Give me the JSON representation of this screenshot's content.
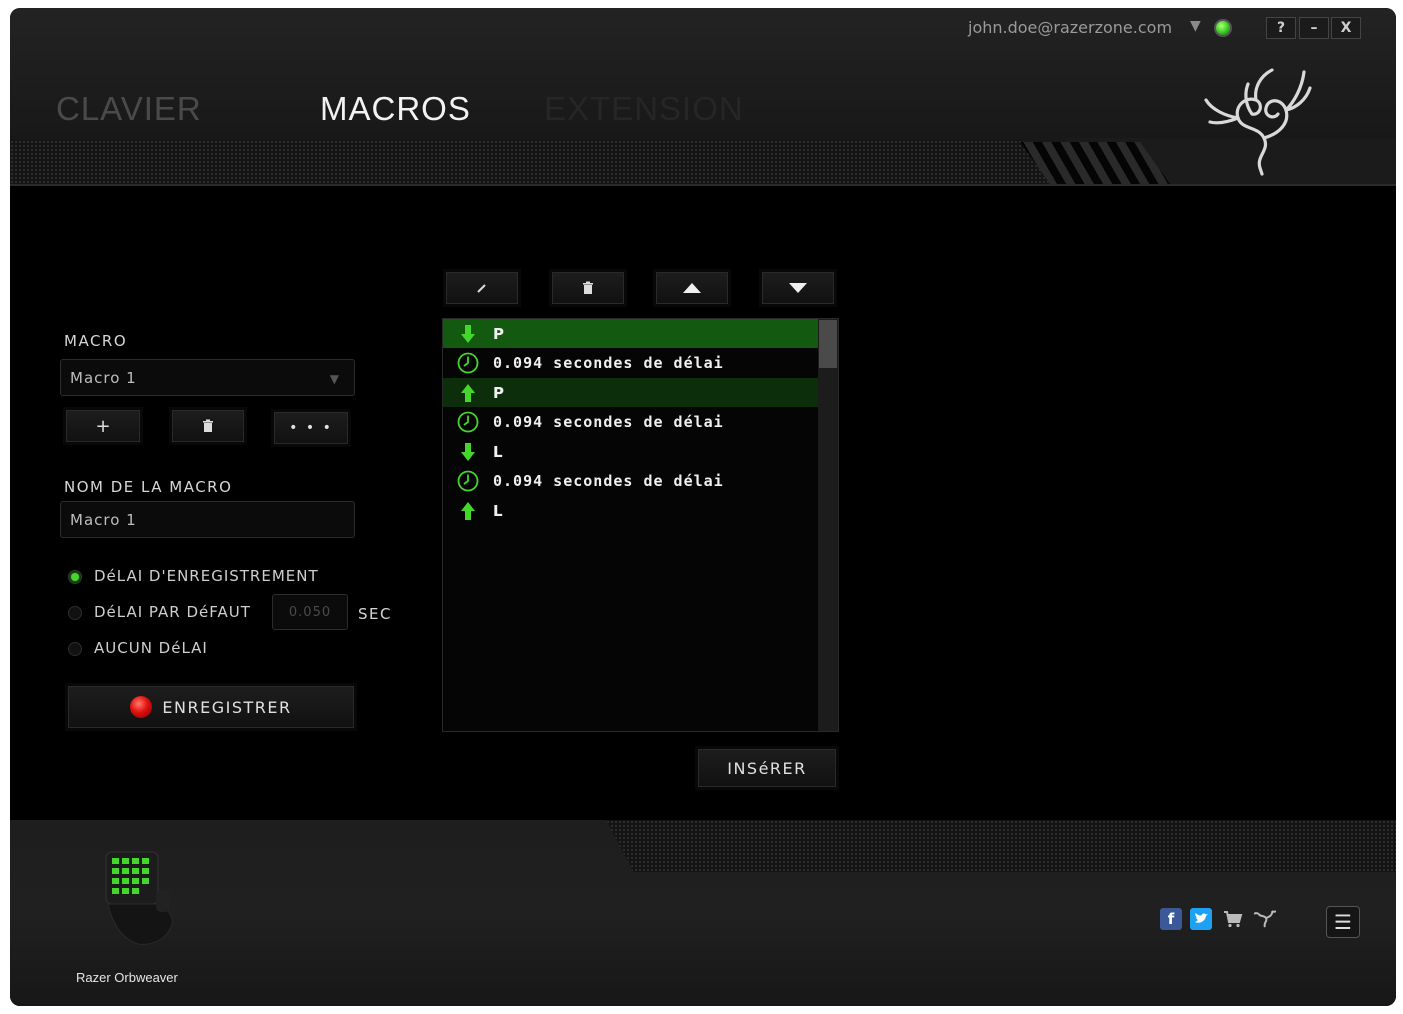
{
  "header": {
    "tabs": [
      {
        "label": "CLAVIER",
        "state": "inactive"
      },
      {
        "label": "MACROS",
        "state": "active"
      },
      {
        "label": "EXTENSION",
        "state": "faded"
      }
    ],
    "user_email": "john.doe@razerzone.com",
    "window_buttons": {
      "help": "?",
      "minimize": "–",
      "close": "X"
    }
  },
  "toolbar": {
    "edit_icon": "pencil-icon",
    "delete_icon": "trash-icon",
    "up_icon": "arrow-up-icon",
    "down_icon": "arrow-down-icon"
  },
  "macro_panel": {
    "macro_label": "MACRO",
    "macro_selected": "Macro 1",
    "add_label": "+",
    "more_label": "• • •",
    "name_label": "NOM DE LA MACRO",
    "name_value": "Macro 1",
    "delay_options": [
      {
        "label": "DéLAI D'ENREGISTREMENT",
        "selected": true
      },
      {
        "label": "DéLAI PAR DéFAUT",
        "selected": false
      },
      {
        "label": "AUCUN DéLAI",
        "selected": false
      }
    ],
    "default_delay_value": "0.050",
    "sec_label": "SEC",
    "record_label": "ENREGISTRER"
  },
  "events": [
    {
      "type": "key-down",
      "text": "P",
      "highlight": "strong"
    },
    {
      "type": "delay",
      "text": "0.094 secondes de délai",
      "highlight": "none"
    },
    {
      "type": "key-up",
      "text": "P",
      "highlight": "weak"
    },
    {
      "type": "delay",
      "text": "0.094 secondes de délai",
      "highlight": "none"
    },
    {
      "type": "key-down",
      "text": "L",
      "highlight": "none"
    },
    {
      "type": "delay",
      "text": "0.094 secondes de délai",
      "highlight": "none"
    },
    {
      "type": "key-up",
      "text": "L",
      "highlight": "none"
    }
  ],
  "insert_label": "INSéRER",
  "footer": {
    "device_name": "Razer Orbweaver",
    "social": [
      "facebook-icon",
      "twitter-icon",
      "cart-icon",
      "razer-icon"
    ],
    "menu_icon": "menu-icon"
  },
  "colors": {
    "accent": "#44d62c",
    "record": "#e01010"
  }
}
